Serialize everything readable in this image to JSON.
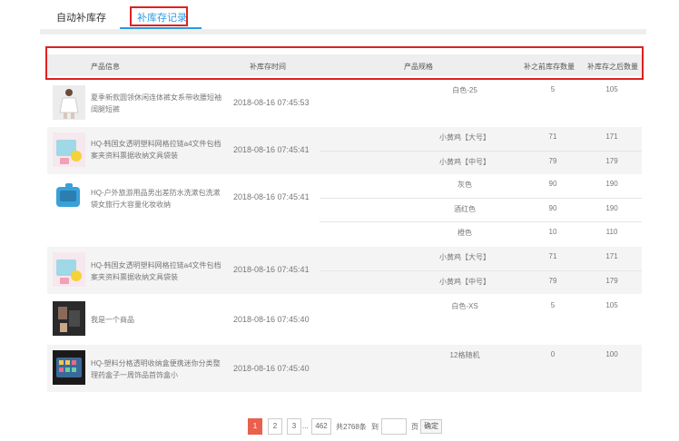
{
  "tabs": [
    {
      "label": "自动补库存"
    },
    {
      "label": "补库存记录"
    }
  ],
  "table": {
    "headers": [
      "产品信息",
      "补库存时间",
      "产品规格",
      "补之前库存数量",
      "补库存之后数量"
    ],
    "groups": [
      {
        "name": "夏季新款圆领休闲连体裤女系带收腰短袖阔腿短裤",
        "time": "2018-08-16 07:45:53",
        "rows": [
          {
            "spec": "白色-25",
            "before": "5",
            "after": "105"
          }
        ]
      },
      {
        "name": "HQ-韩国女透明塑料网格拉链a4文件包档案夹资料票据收纳文具袋装",
        "time": "2018-08-16 07:45:41",
        "rows": [
          {
            "spec": "小黄鸡【大号】",
            "before": "71",
            "after": "171"
          },
          {
            "spec": "小黄鸡【中号】",
            "before": "79",
            "after": "179"
          }
        ]
      },
      {
        "name": "HQ-户外旅游用品男出差防水洗漱包洗漱袋女旅行大容量化妆收纳",
        "time": "2018-08-16 07:45:41",
        "rows": [
          {
            "spec": "灰色",
            "before": "90",
            "after": "190"
          },
          {
            "spec": "酒红色",
            "before": "90",
            "after": "190"
          },
          {
            "spec": "橙色",
            "before": "10",
            "after": "110"
          }
        ]
      },
      {
        "name": "HQ-韩国女透明塑料网格拉链a4文件包档案夹资料票据收纳文具袋装",
        "time": "2018-08-16 07:45:41",
        "rows": [
          {
            "spec": "小黄鸡【大号】",
            "before": "71",
            "after": "171"
          },
          {
            "spec": "小黄鸡【中号】",
            "before": "79",
            "after": "179"
          }
        ]
      },
      {
        "name": "我是一个商品",
        "time": "2018-08-16 07:45:40",
        "rows": [
          {
            "spec": "白色-XS",
            "before": "5",
            "after": "105"
          }
        ]
      },
      {
        "name": "HQ-塑料分格透明收纳盒便携迷你分类整理药盒子一周饰品首饰盒小",
        "time": "2018-08-16 07:45:40",
        "rows": [
          {
            "spec": "12格随机",
            "before": "0",
            "after": "100"
          }
        ]
      }
    ]
  },
  "pagination": {
    "pages": [
      "1",
      "2",
      "3"
    ],
    "ellipsis": "...",
    "last_page": "462",
    "total": "共2768条",
    "goto_label": "到",
    "page_suffix": "页",
    "confirm": "确定"
  },
  "colors": {
    "accent": "#2a9ae2",
    "highlight_box": "#e02020",
    "active_page": "#e9604d"
  }
}
